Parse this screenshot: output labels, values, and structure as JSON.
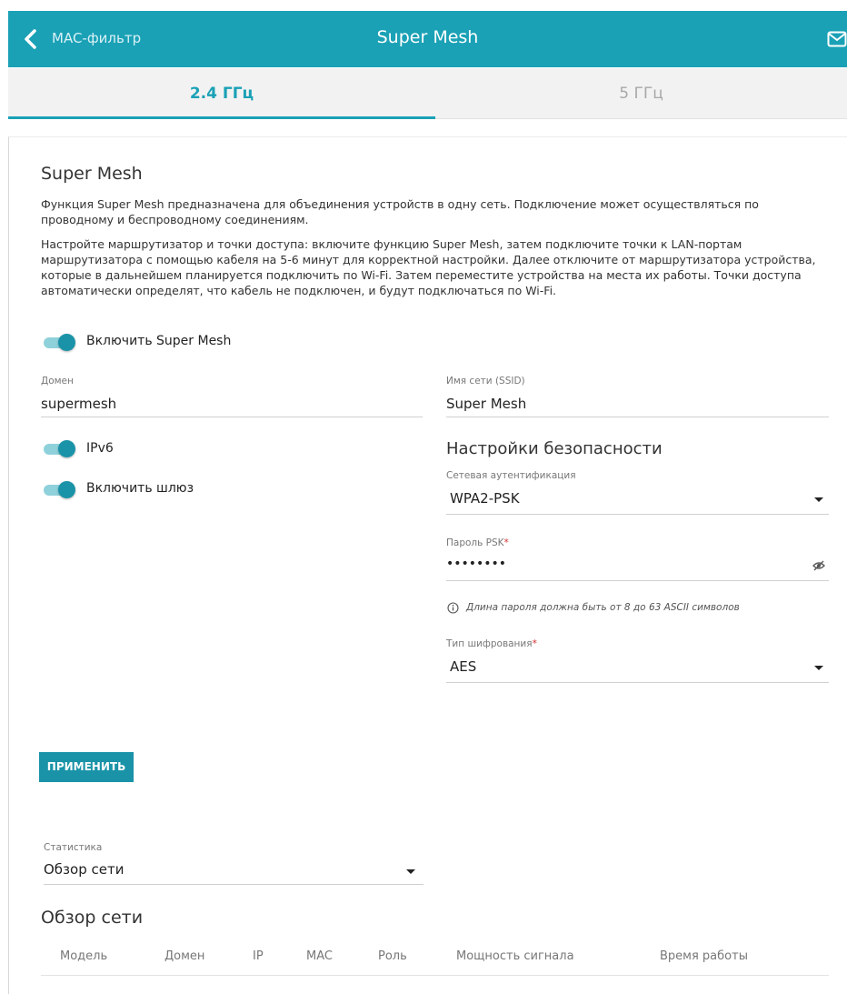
{
  "header": {
    "back_label": "MAC-фильтр",
    "title": "Super Mesh"
  },
  "tabs": [
    {
      "label": "2.4 ГГц",
      "active": true
    },
    {
      "label": "5 ГГц",
      "active": false
    }
  ],
  "section": {
    "title": "Super Mesh",
    "paragraph1": "Функция Super Mesh предназначена для объединения устройств в одну сеть. Подключение может осуществляться по проводному и беспроводному соединениям.",
    "paragraph2": "Настройте маршрутизатор и точки доступа: включите функцию Super Mesh, затем подключите точки к LAN-портам маршрутизатора с помощью кабеля на 5-6 минут для корректной настройки. Далее отключите от маршрутизатора устройства, которые в дальнейшем планируется подключить по Wi-Fi. Затем переместите устройства на места их работы. Точки доступа автоматически определят, что кабель не подключен, и будут подключаться по Wi-Fi."
  },
  "toggles": {
    "enable_mesh": {
      "label": "Включить Super Mesh",
      "on": true
    },
    "ipv6": {
      "label": "IPv6",
      "on": true
    },
    "gateway": {
      "label": "Включить шлюз",
      "on": true
    }
  },
  "fields": {
    "domain": {
      "label": "Домен",
      "value": "supermesh"
    },
    "ssid": {
      "label": "Имя сети (SSID)",
      "value": "Super Mesh"
    }
  },
  "security": {
    "title": "Настройки безопасности",
    "auth_label": "Сетевая аутентификация",
    "auth_value": "WPA2-PSK",
    "psk_label": "Пароль PSK",
    "psk_value": "••••••••",
    "psk_hint": "Длина пароля должна быть от 8 до 63 ASCII символов",
    "cipher_label": "Тип шифрования",
    "cipher_value": "AES",
    "required_mark": "*"
  },
  "apply_label": "ПРИМЕНИТЬ",
  "statistics": {
    "label": "Статистика",
    "value": "Обзор сети"
  },
  "overview": {
    "title": "Обзор сети",
    "columns": [
      "Модель",
      "Домен",
      "IP",
      "MAC",
      "Роль",
      "Мощность сигнала",
      "Время работы"
    ]
  },
  "colors": {
    "accent": "#1aa1b6",
    "button": "#1a93a8"
  }
}
